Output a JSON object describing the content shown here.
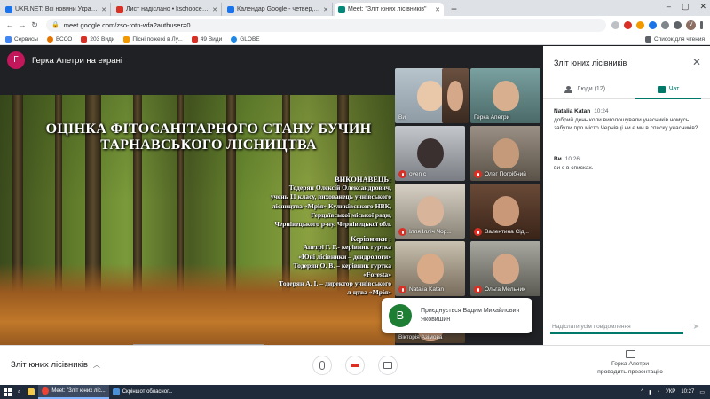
{
  "browser": {
    "tabs": [
      {
        "label": "UKR.NET: Всі новини України, о",
        "color": "#1a73e8"
      },
      {
        "label": "Лист надіслано • kschoocentum@",
        "color": "#d93025"
      },
      {
        "label": "Календар Google - четвер, 15 к",
        "color": "#1a73e8"
      },
      {
        "label": "Meet: \"Зліт юних лісівників\"",
        "color": "#00897b",
        "active": true
      }
    ],
    "new_tab": "+",
    "url": "meet.google.com/zso-rotn-wfa?authuser=0",
    "bookmarks": [
      "Сервисы",
      "ВССО",
      "203 Види",
      "Пісні пожежі в Лу...",
      "49 Види",
      "GLOBE"
    ],
    "bookmarks_right": "Список для чтения",
    "profile_initial": "V"
  },
  "meet": {
    "presenter_initial": "Г",
    "presenter_title": "Герка Апетри на екрані",
    "slide": {
      "title_line1": "ОЦІНКА ФІТОСАНІТАРНОГО СТАНУ БУЧИН",
      "title_line2": "ТАРНАВСЬКОГО ЛІСНИЦТВА",
      "executor_heading": "ВИКОНАВЕЦЬ:",
      "executor_lines": [
        "Тодерян Олексій Олександрович,",
        "учень 11 класу, вихованець учнівського",
        "лісництва «Мрія» Куликівського НВК,",
        "Герцаївської міської ради,",
        "Чернівецького р-ну. Чернівецької обл."
      ],
      "leaders_heading": "Керівники :",
      "leaders_lines": [
        "Апетрі Г. Г.- керівник гуртка",
        "«Юні лісівники – дендрологи»",
        "Тодерян О. В. – керівник гуртка",
        "«Foresta»",
        "Тодерян А. І. – директор учнівського",
        "л-цтва «Мрія»"
      ],
      "share_text": "meet.google.com is sharing your screen.",
      "share_stop": "Остановить показ",
      "share_hide": "Скрыть"
    },
    "participants": [
      {
        "name": "Ви",
        "muted": false
      },
      {
        "name": "",
        "muted": false
      },
      {
        "name": "Герка Апетри",
        "muted": false
      },
      {
        "name": "oven c",
        "muted": true
      },
      {
        "name": "Олег Погрібний",
        "muted": true
      },
      {
        "name": "Ілля Ілліч Чор...",
        "muted": true
      },
      {
        "name": "Валентина Сід...",
        "muted": true
      },
      {
        "name": "Natalia Katan",
        "muted": true
      },
      {
        "name": "Ольга Мельник",
        "muted": true
      },
      {
        "name": "Вікторія Азімова",
        "muted": false
      }
    ],
    "join_toast": {
      "initial": "B",
      "text": "Приєднується Вадим Михайлович Яковишин"
    }
  },
  "panel": {
    "title": "Зліт юних лісівників",
    "tab_people": "Люди (12)",
    "tab_chat": "Чат",
    "messages": [
      {
        "author": "Natalia Katan",
        "time": "10:24",
        "text": "добрий день коли виголошували учасників чомусь забули про місто Чернівці чи є ми в списку учасників?"
      },
      {
        "author": "Ви",
        "time": "10:26",
        "text": "ви є в списках."
      }
    ],
    "input_placeholder": "Надіслати усім повідомлення"
  },
  "bottom": {
    "meeting_name": "Зліт юних лісівників",
    "presenter_line1": "Герка Апетри",
    "presenter_line2": "проводить презентацію"
  },
  "taskbar": {
    "items": [
      "Meet: \"Зліт юних ліс...",
      "Скріншот обласног..."
    ],
    "lang": "УКР",
    "time": "10:27"
  },
  "colors": {
    "accent": "#00796b",
    "end_call": "#d93025",
    "presenter": "#c2185b",
    "join": "#1e7e34"
  }
}
